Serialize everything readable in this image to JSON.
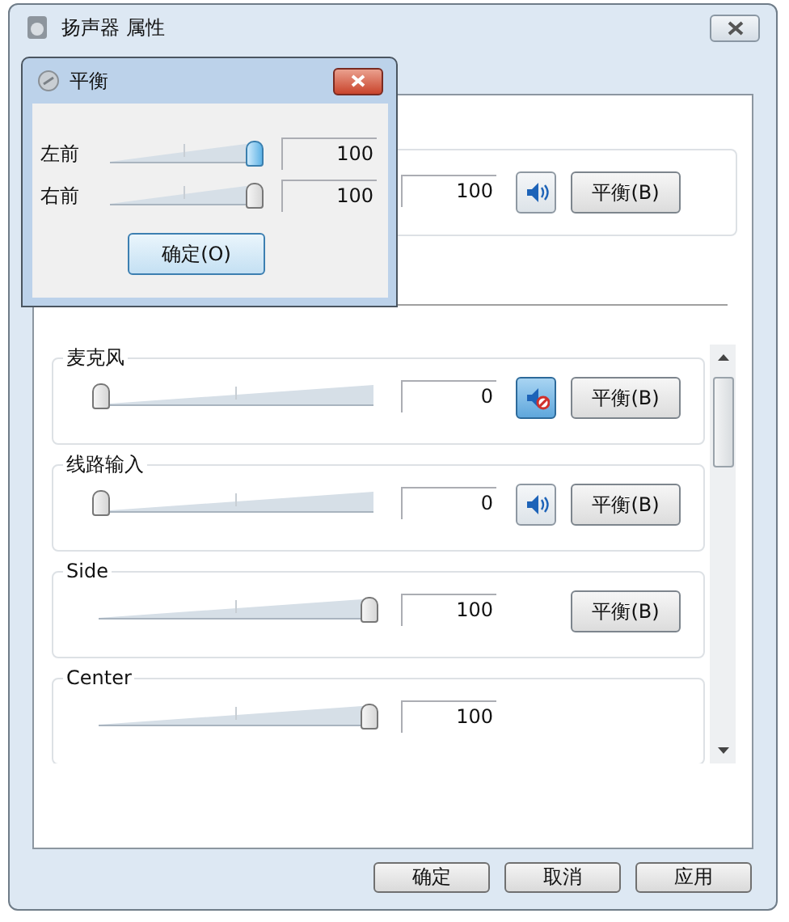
{
  "window": {
    "title": "扬声器 属性"
  },
  "top_row": {
    "value": "100",
    "muted": false,
    "balance_button": "平衡(B)"
  },
  "devices": [
    {
      "name": "麦克风",
      "kind": "mute_balance",
      "level": 0,
      "value": "0",
      "muted": true,
      "balance_button": "平衡(B)"
    },
    {
      "name": "线路输入",
      "kind": "mute_balance",
      "level": 0,
      "value": "0",
      "muted": false,
      "balance_button": "平衡(B)"
    },
    {
      "name": "Side",
      "kind": "balance",
      "level": 1,
      "value": "100",
      "balance_button": "平衡(B)"
    },
    {
      "name": "Center",
      "kind": "plain",
      "level": 1,
      "value": "100"
    }
  ],
  "buttons": [
    "确定",
    "取消",
    "应用"
  ],
  "balance_dialog": {
    "title": "平衡",
    "channels": [
      {
        "label": "左前",
        "level": 1,
        "value": "100",
        "focused": true
      },
      {
        "label": "右前",
        "level": 1,
        "value": "100",
        "focused": false
      }
    ],
    "ok_button": "确定(O)"
  }
}
